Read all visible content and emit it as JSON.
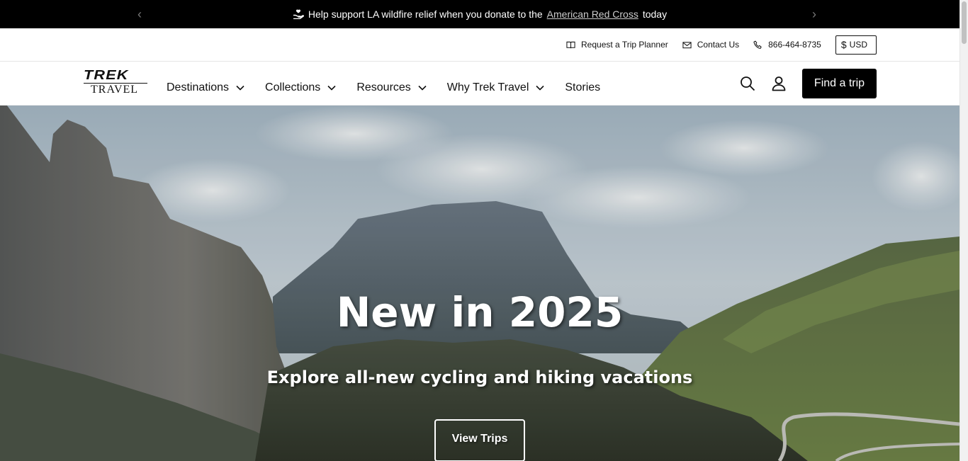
{
  "announcement": {
    "text_before": "Help support LA wildfire relief when you donate to the",
    "link_text": "American Red Cross",
    "text_after": "today",
    "prev_arrow": "‹",
    "next_arrow": "›"
  },
  "utility": {
    "trip_planner": "Request a Trip Planner",
    "contact": "Contact Us",
    "phone": "866-464-8735",
    "currency_symbol": "$",
    "currency": "USD"
  },
  "logo": {
    "top": "TREK",
    "bottom": "TRAVEL"
  },
  "nav": {
    "items": [
      {
        "label": "Destinations"
      },
      {
        "label": "Collections"
      },
      {
        "label": "Resources"
      },
      {
        "label": "Why Trek Travel"
      },
      {
        "label": "Stories"
      }
    ]
  },
  "header": {
    "find_trip": "Find a trip"
  },
  "hero": {
    "title": "New in 2025",
    "subtitle": "Explore all-new cycling and hiking vacations",
    "button": "View Trips"
  },
  "icons": {
    "search": "search-icon",
    "account": "user-icon",
    "planner": "book-icon",
    "contact": "envelope-icon",
    "phone": "phone-icon",
    "donate": "heart-hand-icon"
  }
}
